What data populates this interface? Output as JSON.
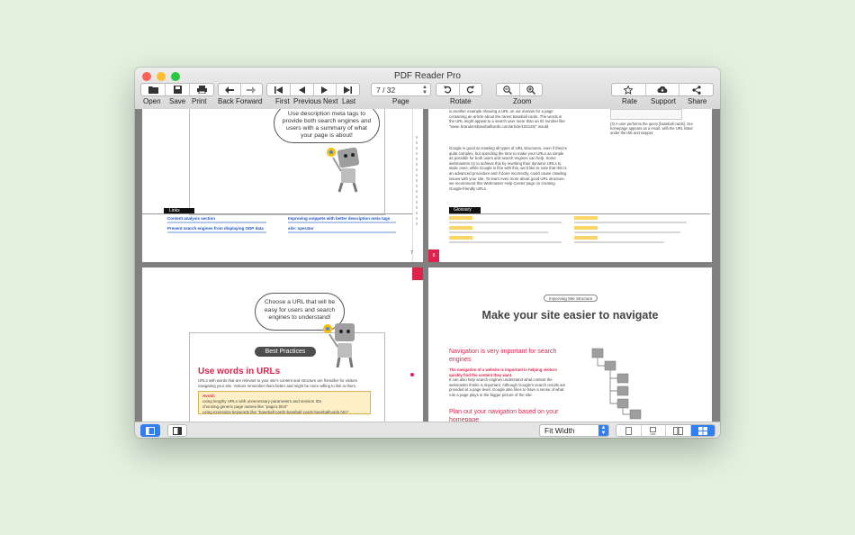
{
  "window": {
    "title": "PDF Reader Pro"
  },
  "colors": {
    "close": "#fe5f57",
    "minimize": "#febc2e",
    "zoom": "#28c840",
    "accent": "#2f7ff2",
    "pdf_red": "#e0224b"
  },
  "toolbar": {
    "open": "Open",
    "save": "Save",
    "print": "Print",
    "back_forward": "Back Forward",
    "first": "First",
    "previous": "Previous",
    "next": "Next",
    "last": "Last",
    "page_label": "Page",
    "page_value": "7 / 32",
    "rotate": "Rotate",
    "zoom": "Zoom",
    "rate": "Rate",
    "support": "Support",
    "share": "Share"
  },
  "icons": [
    "folder-icon",
    "save-icon",
    "printer-icon",
    "arrow-left-icon",
    "arrow-right-icon",
    "first-page-icon",
    "previous-page-icon",
    "next-page-icon",
    "last-page-icon",
    "rotate-left-icon",
    "rotate-right-icon",
    "zoom-out-icon",
    "zoom-in-icon",
    "star-icon",
    "cloud-download-icon",
    "share-icon"
  ],
  "bottom": {
    "zoom_select": "Fit Width"
  },
  "pages": {
    "p1": {
      "bubble": "Use description meta tags to provide both search engines and users with a summary of what your page is about!",
      "links_header": "Links",
      "link1": "Content analysis section",
      "link2": "Improving snippets with better description meta tags",
      "link3": "Prevent search engines from displaying ODP data",
      "link4": "site: operator",
      "page_num": "7"
    },
    "p2": {
      "para1": "is another example showing a URL on our domain for a page containing an article about the rarest baseball cards. The words in the URL might appeal to a search user more than an ID number like \"www. brandonsbaseballcards.com/article/102125/\" would.",
      "para2": "Google is good at crawling all types of URL structures, even if they're quite complex, but spending the time to make your URLs as simple as possible for both users and search engines can help. Some webmasters try to achieve this by rewriting their dynamic URLs to static ones; while Google is fine with this, we'd like to note that this is an advanced procedure and if done incorrectly, could cause crawling issues with your site. To learn even more about good URL structure, we recommend this Webmaster Help Center page on creating Google-friendly URLs.",
      "side": "(3) A user performs the query [baseball cards]. Our homepage appears as a result, with the URL listed under the title and snippet.",
      "glossary": "Glossary",
      "page_num": "8"
    },
    "p3": {
      "bubble": "Choose a URL that will be easy for users and search engines to understand!",
      "badge": "Best Practices",
      "heading": "Use words in URLs",
      "body": "URLs with words that are relevant to your site's content and structure are friendlier for visitors navigating your site. Visitors remember them better and might be more willing to link to them.",
      "avoid_title": "Avoid:",
      "avoid1": "using lengthy URLs with unnecessary parameters and session IDs",
      "avoid2": "choosing generic page names like \"page1.html\"",
      "avoid3": "using excessive keywords like \"baseball-cards-baseball-cards-baseballcards.htm\""
    },
    "p4": {
      "tag": "Improving Site Structure",
      "title": "Make your site easier to navigate",
      "sub1": "Navigation is very important for search engines",
      "bold": "The navigation of a website is important in helping visitors quickly find the content they want.",
      "body": "It can also help search engines understand what content the webmaster thinks is important. Although Google's search results are provided at a page level, Google also likes to have a sense of what role a page plays in the bigger picture of the site.",
      "sub2": "Plan out your navigation based on your homepage"
    }
  }
}
